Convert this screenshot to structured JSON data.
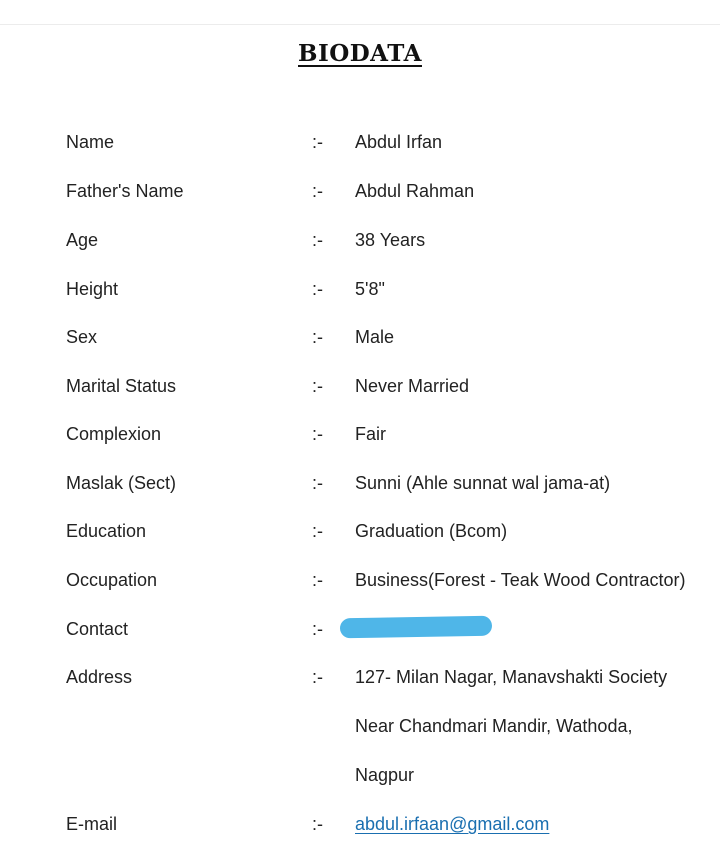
{
  "document": {
    "title": "BIODATA",
    "separator": ":-",
    "fields": {
      "name": {
        "label": "Name",
        "value": "Abdul Irfan"
      },
      "father": {
        "label": "Father's Name",
        "value": "Abdul Rahman"
      },
      "age": {
        "label": "Age",
        "value": "38 Years"
      },
      "height": {
        "label": "Height",
        "value": "5'8\""
      },
      "sex": {
        "label": "Sex",
        "value": "Male"
      },
      "marital": {
        "label": "Marital Status",
        "value": "Never Married"
      },
      "complexion": {
        "label": "Complexion",
        "value": "Fair"
      },
      "maslak": {
        "label": "Maslak (Sect)",
        "value": "Sunni (Ahle sunnat wal jama-at)"
      },
      "education": {
        "label": "Education",
        "value": "Graduation (Bcom)"
      },
      "occupation": {
        "label": "Occupation",
        "value": "Business(Forest - Teak Wood Contractor)"
      },
      "contact": {
        "label": "Contact",
        "value": ""
      },
      "address": {
        "label": "Address",
        "lines": [
          "127- Milan Nagar, Manavshakti Society",
          "Near Chandmari Mandir, Wathoda,",
          "Nagpur"
        ]
      },
      "email": {
        "label": "E-mail",
        "value": "abdul.irfaan@gmail.com"
      }
    },
    "redaction_color": "#4fb6e8",
    "link_color": "#1a6fb0"
  }
}
